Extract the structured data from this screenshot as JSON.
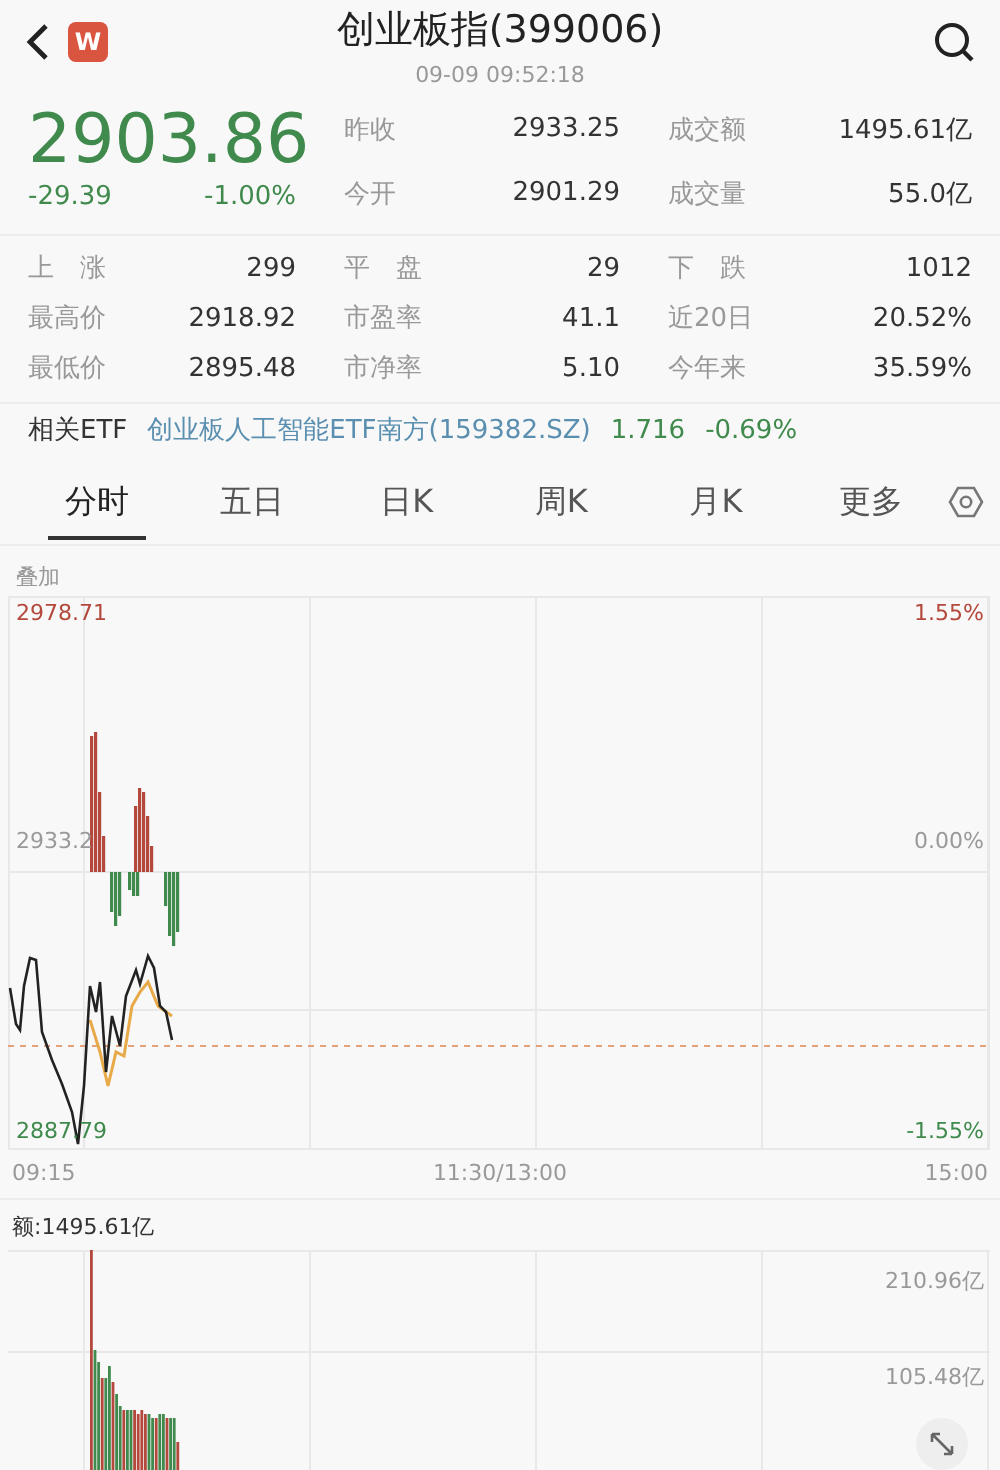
{
  "header": {
    "title": "创业板指(399006)",
    "time": "09-09 09:52:18",
    "logo": "W"
  },
  "quote": {
    "price": "2903.86",
    "change": "-29.39",
    "change_pct": "-1.00%"
  },
  "quote_stats": [
    [
      {
        "label": "昨收",
        "value": "2933.25"
      },
      {
        "label": "成交额",
        "value": "1495.61亿"
      }
    ],
    [
      {
        "label": "今开",
        "value": "2901.29"
      },
      {
        "label": "成交量",
        "value": "55.0亿"
      }
    ]
  ],
  "market_stats": [
    [
      {
        "label": "上　涨",
        "value": "299"
      },
      {
        "label": "平　盘",
        "value": "29"
      },
      {
        "label": "下　跌",
        "value": "1012"
      }
    ],
    [
      {
        "label": "最高价",
        "value": "2918.92"
      },
      {
        "label": "市盈率",
        "value": "41.1"
      },
      {
        "label": "近20日",
        "value": "20.52%"
      }
    ],
    [
      {
        "label": "最低价",
        "value": "2895.48"
      },
      {
        "label": "市净率",
        "value": "5.10"
      },
      {
        "label": "今年来",
        "value": "35.59%"
      }
    ]
  ],
  "related_etf": {
    "label": "相关ETF",
    "name": "创业板人工智能ETF南方(159382.SZ)",
    "price": "1.716",
    "change_pct": "-0.69%"
  },
  "tabs": [
    {
      "label": "分时",
      "selected": true
    },
    {
      "label": "五日",
      "selected": false
    },
    {
      "label": "日K",
      "selected": false
    },
    {
      "label": "周K",
      "selected": false
    },
    {
      "label": "月K",
      "selected": false
    },
    {
      "label": "更多",
      "selected": false
    }
  ],
  "overlay_label": "叠加",
  "price_chart": {
    "y_high": "2978.71",
    "y_mid": "2933.2",
    "y_low": "2887.79",
    "pct_high": "1.55%",
    "pct_mid": "0.00%",
    "pct_low": "-1.55%",
    "x_start": "09:15",
    "x_mid": "11:30/13:00",
    "x_end": "15:00"
  },
  "volume_chart": {
    "label": "额:1495.61亿",
    "y_high": "210.96亿",
    "y_mid": "105.48亿"
  }
}
